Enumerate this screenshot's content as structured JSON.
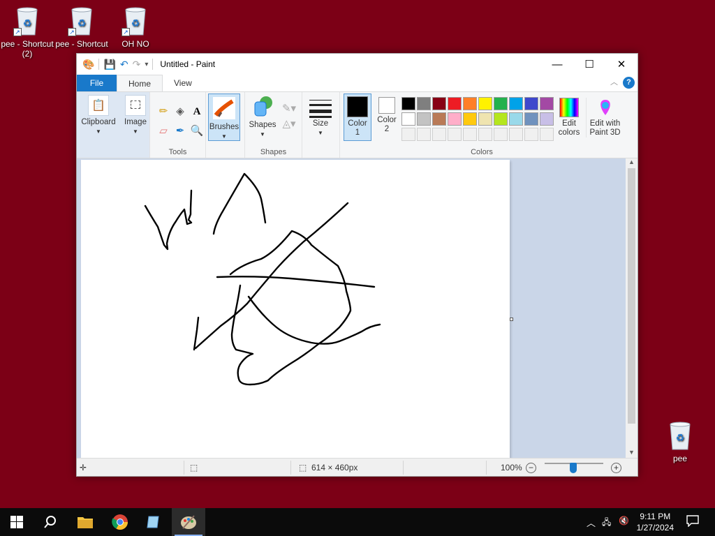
{
  "desktop": {
    "icons": [
      {
        "label": "pee - Shortcut (2)"
      },
      {
        "label": "pee - Shortcut"
      },
      {
        "label": "OH NO"
      },
      {
        "label": "pee"
      }
    ]
  },
  "window": {
    "title": "Untitled - Paint",
    "caption": {
      "minimize": "—",
      "maximize": "☐",
      "close": "✕"
    },
    "tabs": {
      "file": "File",
      "home": "Home",
      "view": "View"
    },
    "help": "?",
    "ribbon": {
      "clipboard": "Clipboard",
      "image": "Image",
      "tools": "Tools",
      "brushes": "Brushes",
      "shapes_btn": "Shapes",
      "shapes_group": "Shapes",
      "size": "Size",
      "color1": "Color 1",
      "color2": "Color 2",
      "colors_group": "Colors",
      "edit_colors": "Edit colors",
      "edit_paint3d": "Edit with Paint 3D",
      "palette_row1": [
        "#000000",
        "#7f7f7f",
        "#880015",
        "#ed1c24",
        "#ff7f27",
        "#fff200",
        "#22b14c",
        "#00a2e8",
        "#3f48cc",
        "#a349a4"
      ],
      "palette_row2": [
        "#ffffff",
        "#c3c3c3",
        "#b97a57",
        "#ffaec9",
        "#ffc90e",
        "#efe4b0",
        "#b5e61d",
        "#99d9ea",
        "#7092be",
        "#c8bfe7"
      ],
      "color1_value": "#000000",
      "color2_value": "#ffffff"
    },
    "status": {
      "canvas_size": "614 × 460px",
      "zoom": "100%"
    }
  },
  "taskbar": {
    "time": "9:11 PM",
    "date": "1/27/2024"
  }
}
